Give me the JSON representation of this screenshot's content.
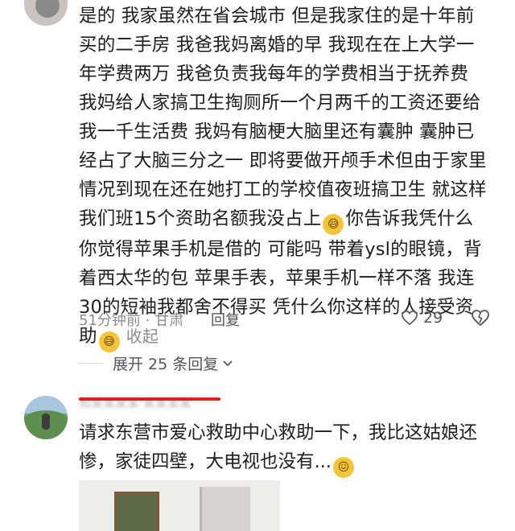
{
  "comment1": {
    "lines": [
      "是的 我家虽然在省会城市 但是我家住的是十年前",
      "买的二手房 我爸我妈离婚的早 我现在在上大学一",
      "年学费两万 我爸负责我每年的学费相当于抚养费",
      "我妈给人家搞卫生掏厕所一个月两千的工资还要给",
      "我一千生活费 我妈有脑梗大脑里还有囊肿 囊肿已",
      "经占了大脑三分之一 即将要做开颅手术但由于家里",
      "情况到现在还在她打工的学校值夜班搞卫生 就这样",
      "我们班15个资助名额我没占上",
      "你告诉我凭什么",
      "你觉得苹果手机是借的 可能吗 带着ysl的眼镜，背",
      "着西太华的包 苹果手表，苹果手机一样不落 我连",
      "30的短袖我都舍不得买 凭什么你这样的人接受资",
      "助"
    ],
    "collapse_label": "收起",
    "time_location": "51分钟前 · 甘肃",
    "reply_label": "回复",
    "like_count": "29",
    "emoji": "laughing-with-sweat-emoji"
  },
  "thread": {
    "expand_label": "展开 25 条回复"
  },
  "comment2": {
    "username_obscured": "知某某某某 某某某某",
    "text": "请求东营市爱心救助中心救助一下，我比这姑娘还\n惨，家徒四壁，大电视也没有...",
    "emoji": "embarrassed-face-emoji"
  },
  "colors": {
    "text": "#1e1e1e",
    "muted": "#8d8d8d",
    "redaction": "#e02020",
    "emoji": "#f5c43b"
  }
}
